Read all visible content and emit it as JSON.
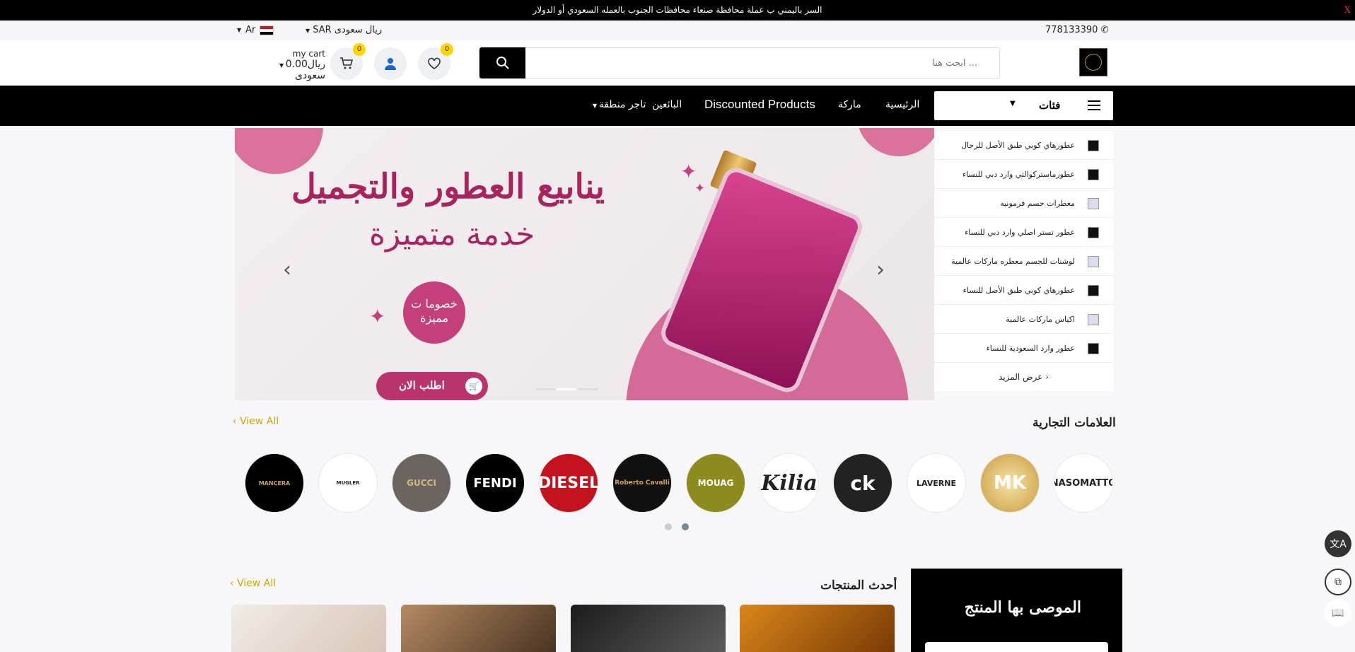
{
  "topbar": {
    "notice": "السر باليمني ب عملة محافظة صنعاء محافظات الجنوب بالعمله السعودي أو الدولار",
    "close": "X"
  },
  "util": {
    "phone": "778133390",
    "currency": "SAR ريال سعودى",
    "lang": "Ar"
  },
  "header": {
    "search_placeholder": "ابحث هنا ...",
    "wishlist_count": "0",
    "cart_count": "0",
    "cart_label": "my cart",
    "cart_total": "0.00ريال سعودى"
  },
  "nav": {
    "categories": "فئات",
    "home": "الرئيسية",
    "brand": "ماركة",
    "discounted": "Discounted Products",
    "sellers": "البائعين",
    "zone_seller": "تاجر منطقة"
  },
  "categories": [
    "عطورهاي كوبي طبق الأصل للرجال",
    "عطورماستركوالتي وارد دبي للنساء",
    "معطرات جسم فرمونيه",
    "عطور تستر اصلي وارد دبي للنساء",
    "لوشنات للجسم معطره ماركات عالمية",
    "عطورهاي كوبي طبق الأصل للنساء",
    "اكياس ماركات عالمية",
    "عطور وارد السعودية للنساء"
  ],
  "show_more": "عرض المزيد",
  "hero": {
    "headline": "ينابيع العطور والتجميل",
    "subline": "خدمة متميزة",
    "sticker": "خصوما ت مميزة",
    "order": "اطلب الان"
  },
  "brands_section": {
    "title": "العلامات التجارية",
    "view_all": "View All"
  },
  "brands": [
    "NASOMATTO",
    "MK",
    "LAVERNE",
    "ck",
    "Kilia",
    "MOUAG",
    "Roberto Cavalli",
    "DIESEL",
    "FENDI",
    "GUCCI",
    "MUGLER",
    "MANCERA"
  ],
  "latest_section": {
    "title": "أحدث المنتجات",
    "view_all": "View All"
  },
  "recommended": {
    "title": "الموصى بها المنتج"
  },
  "colors": {
    "accent": "#ffd400",
    "brand_pink": "#a8245f",
    "nav_bg": "#000000"
  }
}
